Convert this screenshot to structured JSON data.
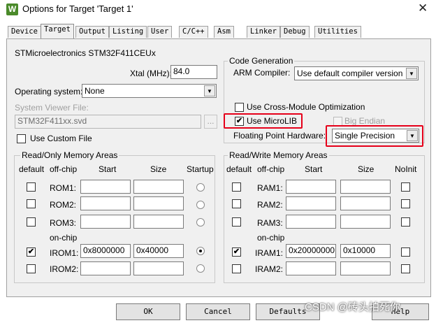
{
  "window": {
    "title": "Options for Target 'Target 1'",
    "icon": "keil-logo-icon",
    "close": "✕"
  },
  "tabs": [
    "Device",
    "Target",
    "Output",
    "Listing",
    "User",
    "C/C++",
    "Asm",
    "Linker",
    "Debug",
    "Utilities"
  ],
  "active_tab": "Target",
  "device": {
    "name": "STMicroelectronics STM32F411CEUx"
  },
  "xtal": {
    "label": "Xtal (MHz):",
    "value": "84.0"
  },
  "os": {
    "label": "Operating system:",
    "value": "None"
  },
  "svd": {
    "label": "System Viewer File:",
    "value": "STM32F411xx.svd",
    "browse": "..."
  },
  "custom_file": {
    "label": "Use Custom File",
    "checked": false
  },
  "codegen": {
    "title": "Code Generation",
    "arm_compiler_label": "ARM Compiler:",
    "arm_compiler_value": "Use default compiler version",
    "cross_module_label": "Use Cross-Module Optimization",
    "microlib_label": "Use MicroLIB",
    "microlib_check": "✔",
    "big_endian_label": "Big Endian",
    "fph_label": "Floating Point Hardware:",
    "fph_value": "Single Precision"
  },
  "ro_memory": {
    "title": "Read/Only Memory Areas",
    "headers": {
      "default": "default",
      "offchip": "off-chip",
      "start": "Start",
      "size": "Size",
      "startup": "Startup"
    },
    "onchip_label": "on-chip",
    "rows": [
      {
        "name": "ROM1:",
        "start": "",
        "size": "",
        "default": false,
        "startup": false
      },
      {
        "name": "ROM2:",
        "start": "",
        "size": "",
        "default": false,
        "startup": false
      },
      {
        "name": "ROM3:",
        "start": "",
        "size": "",
        "default": false,
        "startup": false
      },
      {
        "name": "IROM1:",
        "start": "0x8000000",
        "size": "0x40000",
        "default": true,
        "startup": true
      },
      {
        "name": "IROM2:",
        "start": "",
        "size": "",
        "default": false,
        "startup": false
      }
    ]
  },
  "rw_memory": {
    "title": "Read/Write Memory Areas",
    "headers": {
      "default": "default",
      "offchip": "off-chip",
      "start": "Start",
      "size": "Size",
      "noinit": "NoInit"
    },
    "onchip_label": "on-chip",
    "rows": [
      {
        "name": "RAM1:",
        "start": "",
        "size": "",
        "default": false
      },
      {
        "name": "RAM2:",
        "start": "",
        "size": "",
        "default": false
      },
      {
        "name": "RAM3:",
        "start": "",
        "size": "",
        "default": false
      },
      {
        "name": "IRAM1:",
        "start": "0x20000000",
        "size": "0x10000",
        "default": true
      },
      {
        "name": "IRAM2:",
        "start": "",
        "size": "",
        "default": false
      }
    ]
  },
  "buttons": {
    "ok": "OK",
    "cancel": "Cancel",
    "defaults": "Defaults",
    "help": "Help"
  },
  "watermark": "CSDN @砖头拍死你",
  "colors": {
    "highlight": "#e6001a",
    "panel": "#f0f0f0"
  }
}
